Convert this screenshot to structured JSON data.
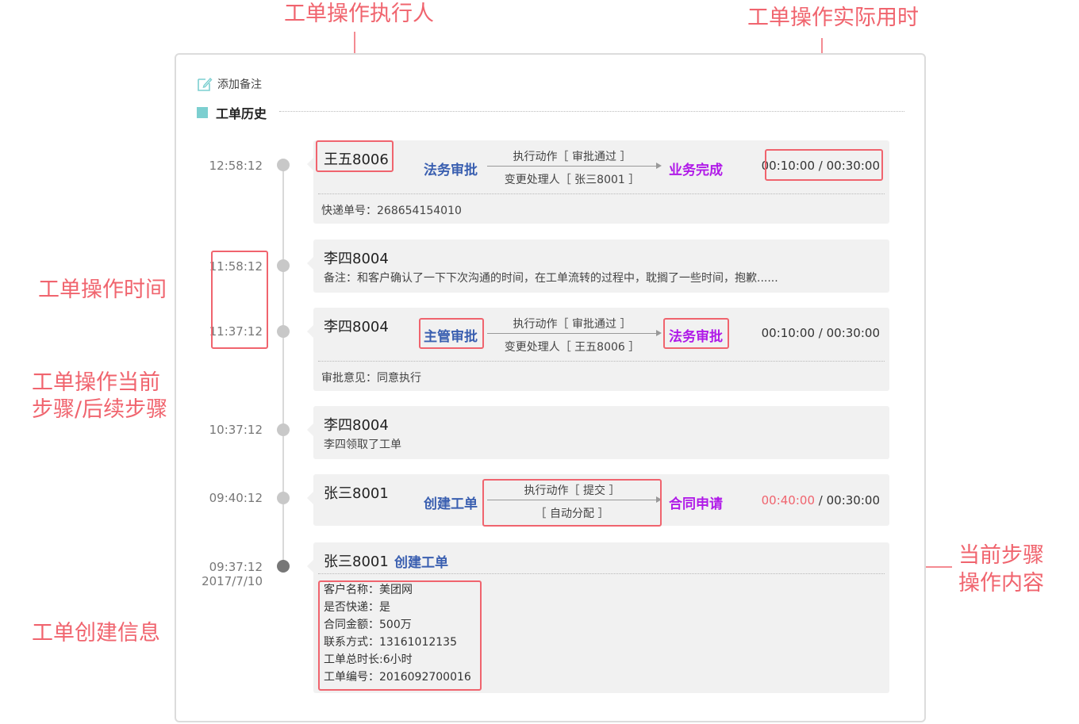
{
  "annotations": {
    "executor": "工单操作执行人",
    "actual_time": "工单操作实际用时",
    "op_time": "工单操作时间",
    "steps_line1": "工单操作当前",
    "steps_line2": "步骤/后续步骤",
    "content_line1": "当前步骤",
    "content_line2": "操作内容",
    "create_info": "工单创建信息"
  },
  "toolbar": {
    "add_note": "添加备注",
    "add_note_icon": "edit-icon"
  },
  "section": {
    "title": "工单历史"
  },
  "entries": [
    {
      "time": "12:58:12",
      "user": "王五8006",
      "from_step": "法务审批",
      "action_top": "执行动作［ 审批通过 ］",
      "action_bottom": "变更处理人［ 张三8001 ］",
      "to_step": "业务完成",
      "duration_used": "00:10:00",
      "duration_sep": "/",
      "duration_limit": "00:30:00",
      "note": "快递单号：268654154010"
    },
    {
      "time": "11:58:12",
      "user": "李四8004",
      "note": "备注：和客户确认了一下下次沟通的时间，在工单流转的过程中，耽搁了一些时间，抱歉......"
    },
    {
      "time": "11:37:12",
      "user": "李四8004",
      "from_step": "主管审批",
      "action_top": "执行动作［ 审批通过 ］",
      "action_bottom": "变更处理人［ 王五8006 ］",
      "to_step": "法务审批",
      "duration_used": "00:10:00",
      "duration_sep": "/",
      "duration_limit": "00:30:00",
      "note": "审批意见：同意执行"
    },
    {
      "time": "10:37:12",
      "user": "李四8004",
      "note": "李四领取了工单"
    },
    {
      "time": "09:40:12",
      "user": "张三8001",
      "from_step": "创建工单",
      "action_top": "执行动作［ 提交 ］",
      "action_bottom": "［ 自动分配 ］",
      "to_step": "合同申请",
      "duration_used": "00:40:00",
      "duration_sep": "/",
      "duration_limit": "00:30:00"
    },
    {
      "time": "09:37:12",
      "date": "2017/7/10",
      "user": "张三8001",
      "step": "创建工单",
      "info": [
        "客户名称：美团网",
        "是否快递：是",
        "合同金额：500万",
        "联系方式：13161012135",
        "工单总时长:6小时",
        "工单编号：2016092700016"
      ]
    }
  ],
  "colors": {
    "annotation": "#f0646e",
    "step_blue": "#3a5fb0",
    "step_purple": "#b01ae8",
    "section_marker": "#7ccfd0",
    "overdue": "#f0646e"
  }
}
